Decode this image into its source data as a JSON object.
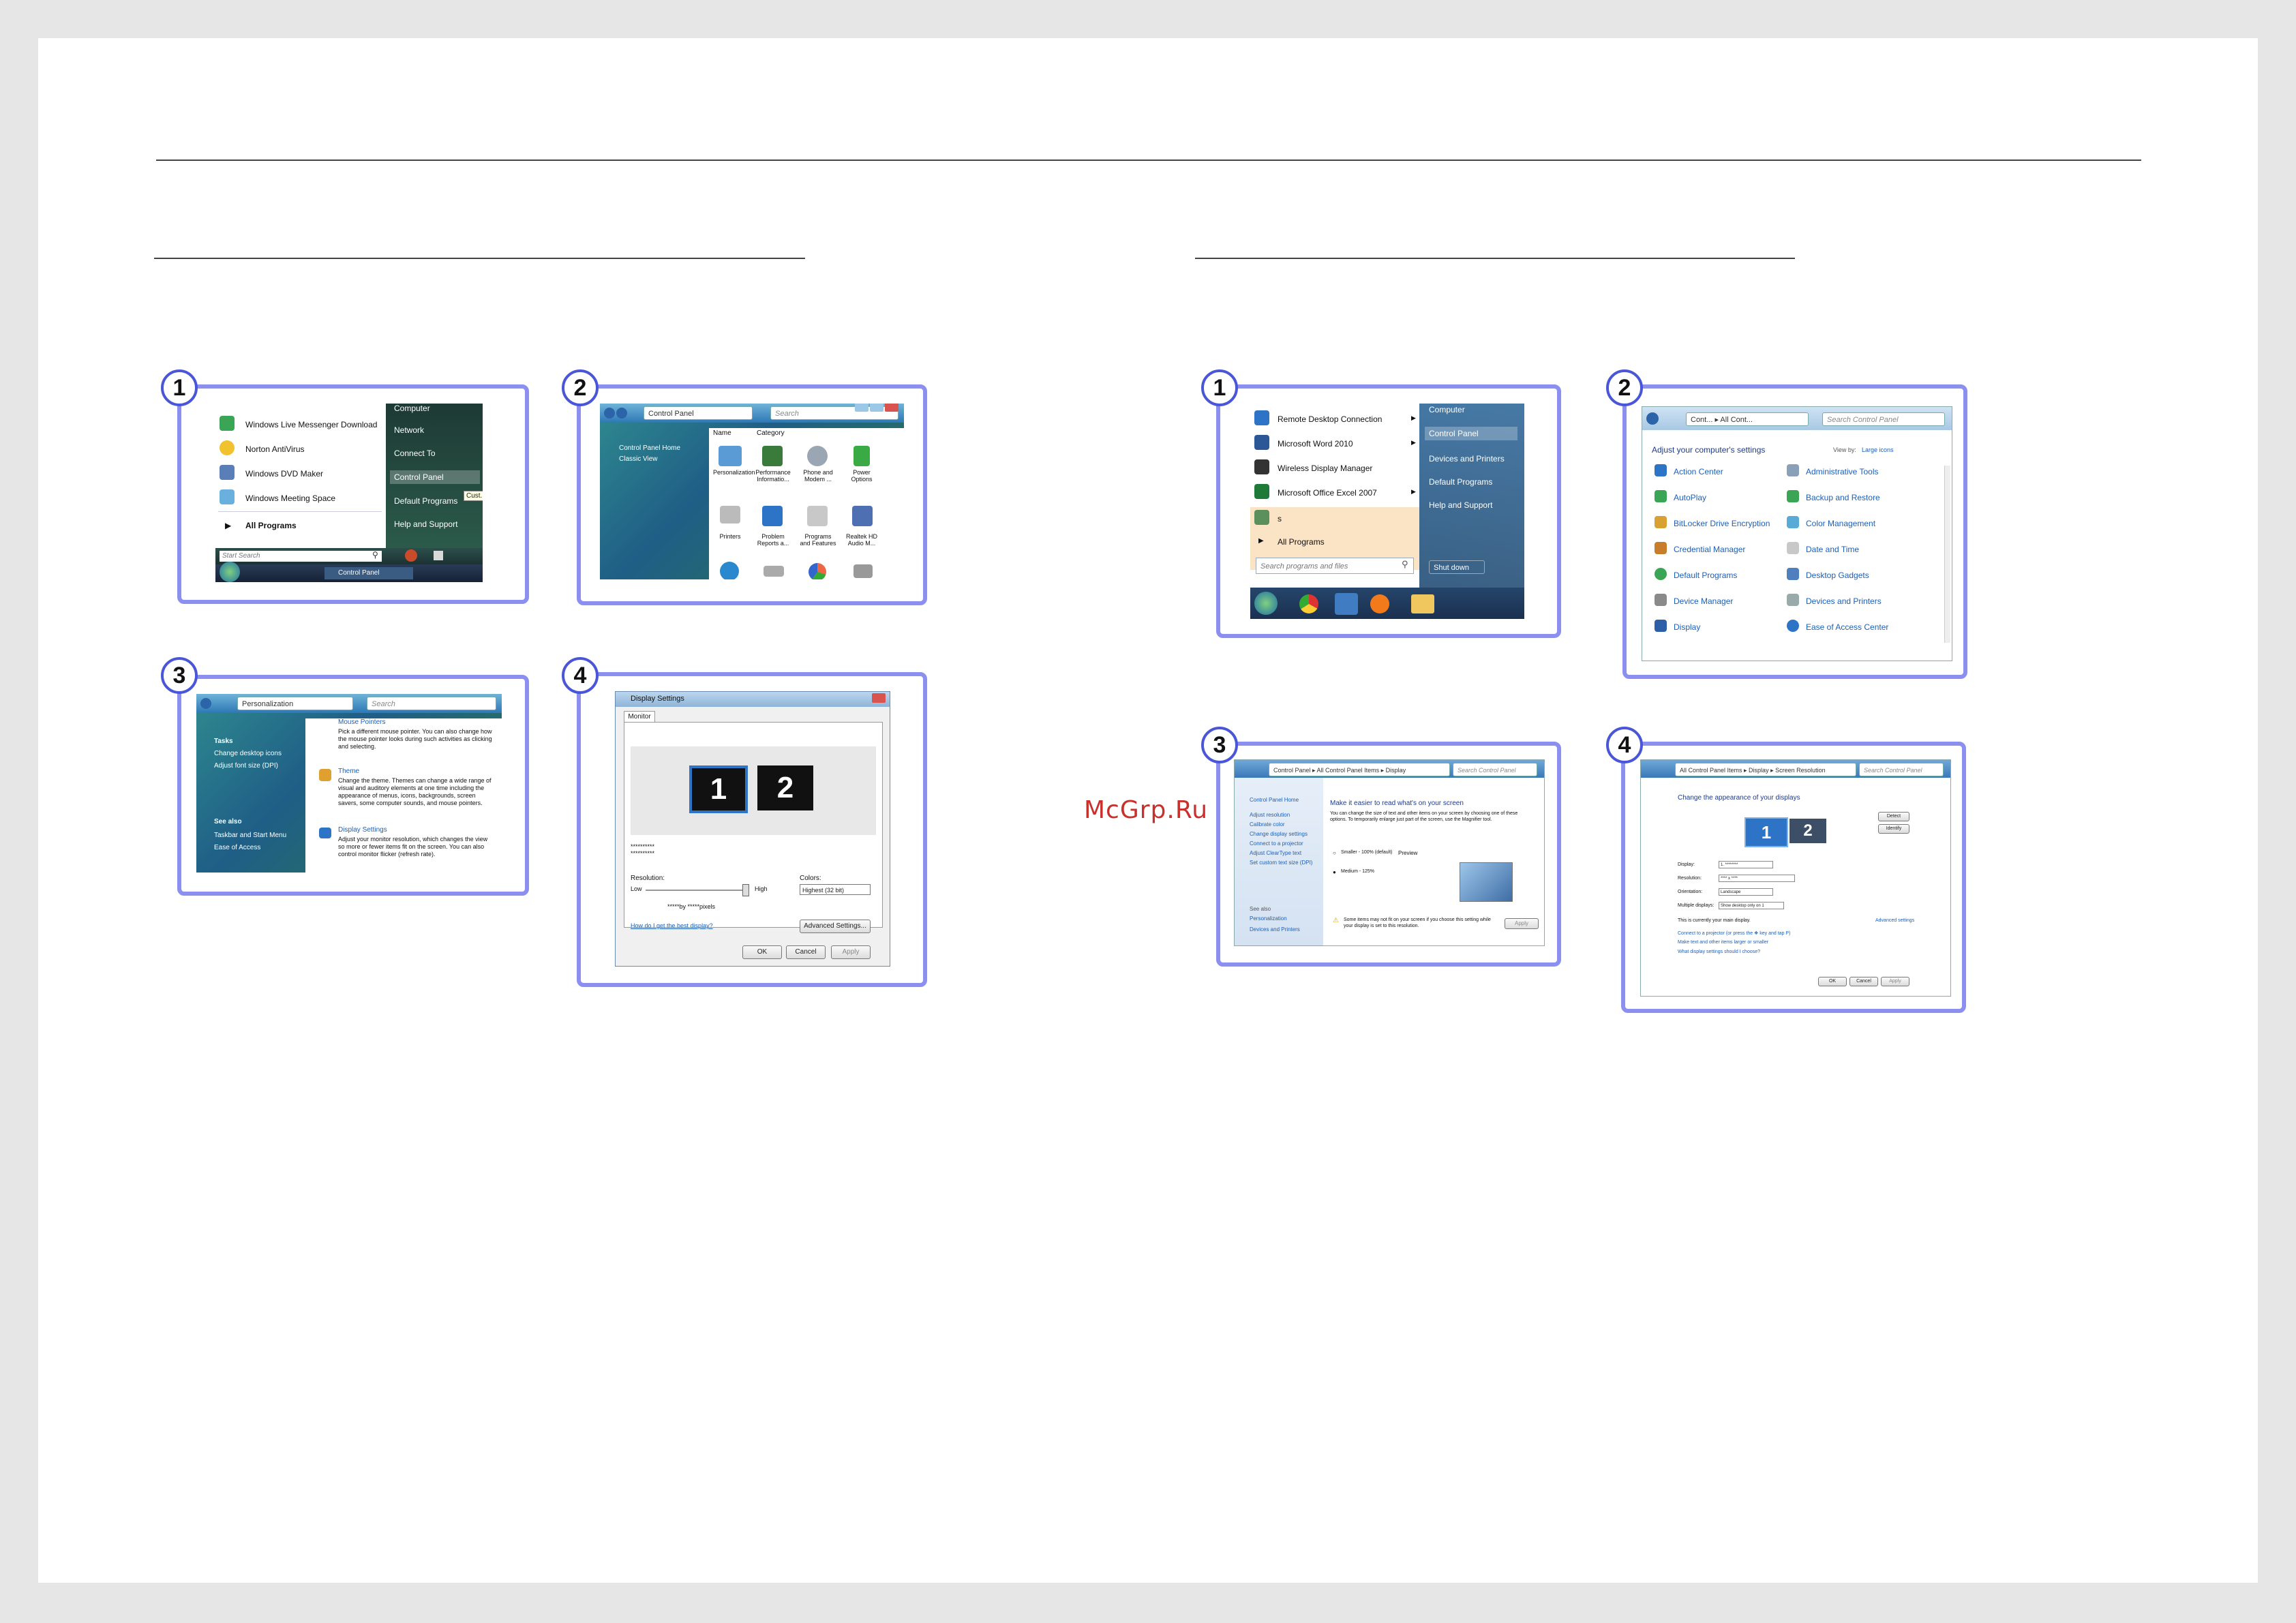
{
  "watermark": "McGrp.Ru",
  "badges": [
    "1",
    "2",
    "3",
    "4"
  ],
  "vista": {
    "start_menu": {
      "left_items": [
        "Windows Live Messenger Download",
        "Norton AntiVirus",
        "Windows DVD Maker",
        "Windows Meeting Space"
      ],
      "all_programs": "All Programs",
      "search_placeholder": "Start Search",
      "right_items": [
        "Computer",
        "Network",
        "Connect To",
        "Control Panel",
        "Default Programs",
        "Help and Support"
      ],
      "tooltip": "Cust...",
      "taskbar_item": "Control Panel"
    },
    "control_panel": {
      "address": "Control Panel",
      "search": "Search",
      "side_items": [
        "Control Panel Home",
        "Classic View"
      ],
      "columns": [
        "Name",
        "Category"
      ],
      "items": [
        "Personalization",
        "Performance Informatio...",
        "Phone and Modem ...",
        "Power Options",
        "Printers",
        "Problem Reports a...",
        "Programs and Features",
        "Realtek HD Audio M..."
      ]
    },
    "personalization": {
      "address": "Personalization",
      "search": "Search",
      "tasks_title": "Tasks",
      "tasks": [
        "Change desktop icons",
        "Adjust font size (DPI)"
      ],
      "see_also_title": "See also",
      "see_also": [
        "Taskbar and Start Menu",
        "Ease of Access"
      ],
      "mouse_title": "Mouse Pointers",
      "mouse_text": "Pick a different mouse pointer. You can also change how the mouse pointer looks during such activities as clicking and selecting.",
      "theme_title": "Theme",
      "theme_text": "Change the theme. Themes can change a wide range of visual and auditory elements at one time including the appearance of menus, icons, backgrounds, screen savers, some computer sounds, and mouse pointers.",
      "display_title": "Display Settings",
      "display_text": "Adjust your monitor resolution, which changes the view so more or fewer items fit on the screen. You can also control monitor flicker (refresh rate)."
    },
    "display_settings": {
      "title": "Display Settings",
      "tab": "Monitor",
      "monitors": [
        "1",
        "2"
      ],
      "monitor_name": "**********",
      "monitor_name2": "**********",
      "resolution_label": "Resolution:",
      "low": "Low",
      "high": "High",
      "res_value": "*****by *****pixels",
      "colors_label": "Colors:",
      "colors_value": "Highest (32 bit)",
      "help_link": "How do I get the best display?",
      "advanced": "Advanced Settings...",
      "ok": "OK",
      "cancel": "Cancel",
      "apply": "Apply"
    }
  },
  "win7": {
    "start_menu": {
      "left_items": [
        "Remote Desktop Connection",
        "Microsoft Word 2010",
        "Wireless Display Manager",
        "Microsoft Office Excel 2007",
        "s"
      ],
      "all_programs": "All Programs",
      "search_placeholder": "Search programs and files",
      "right_items": [
        "Computer",
        "Control Panel",
        "Devices and Printers",
        "Default Programs",
        "Help and Support"
      ],
      "shutdown": "Shut down"
    },
    "control_panel": {
      "address": "Cont... ▸ All Cont...",
      "search": "Search Control Panel",
      "heading": "Adjust your computer's settings",
      "view_by": "View by:",
      "view_value": "Large icons",
      "left": [
        "Action Center",
        "AutoPlay",
        "BitLocker Drive Encryption",
        "Credential Manager",
        "Default Programs",
        "Device Manager",
        "Display"
      ],
      "right": [
        "Administrative Tools",
        "Backup and Restore",
        "Color Management",
        "Date and Time",
        "Desktop Gadgets",
        "Devices and Printers",
        "Ease of Access Center"
      ]
    },
    "display": {
      "address": "Control Panel ▸ All Control Panel Items ▸ Display",
      "search": "Search Control Panel",
      "side": [
        "Control Panel Home",
        "Adjust resolution",
        "Calibrate color",
        "Change display settings",
        "Connect to a projector",
        "Adjust ClearType text",
        "Set custom text size (DPI)"
      ],
      "see_also_title": "See also",
      "see_also": [
        "Personalization",
        "Devices and Printers"
      ],
      "heading": "Make it easier to read what's on your screen",
      "text": "You can change the size of text and other items on your screen by choosing one of these options. To temporarily enlarge just part of the screen, use the Magnifier tool.",
      "option1": "Smaller - 100% (default)",
      "preview": "Preview",
      "option2": "Medium - 125%",
      "warning": "Some items may not fit on your screen if you choose this setting while your display is set to this resolution.",
      "apply": "Apply"
    },
    "resolution": {
      "address": "All Control Panel Items ▸ Display ▸ Screen Resolution",
      "search": "Search Control Panel",
      "heading": "Change the appearance of your displays",
      "detect": "Detect",
      "identify": "Identify",
      "monitors": [
        "1",
        "2"
      ],
      "labels": [
        "Display:",
        "Resolution:",
        "Orientation:",
        "Multiple displays:"
      ],
      "values": [
        "1. ********",
        "**** x ****",
        "Landscape",
        "Show desktop only on 1"
      ],
      "main_display": "This is currently your main display.",
      "advanced": "Advanced settings",
      "links": [
        "Connect to a projector (or press the ❖ key and tap P)",
        "Make text and other items larger or smaller",
        "What display settings should I choose?"
      ],
      "ok": "OK",
      "cancel": "Cancel",
      "apply": "Apply"
    }
  }
}
